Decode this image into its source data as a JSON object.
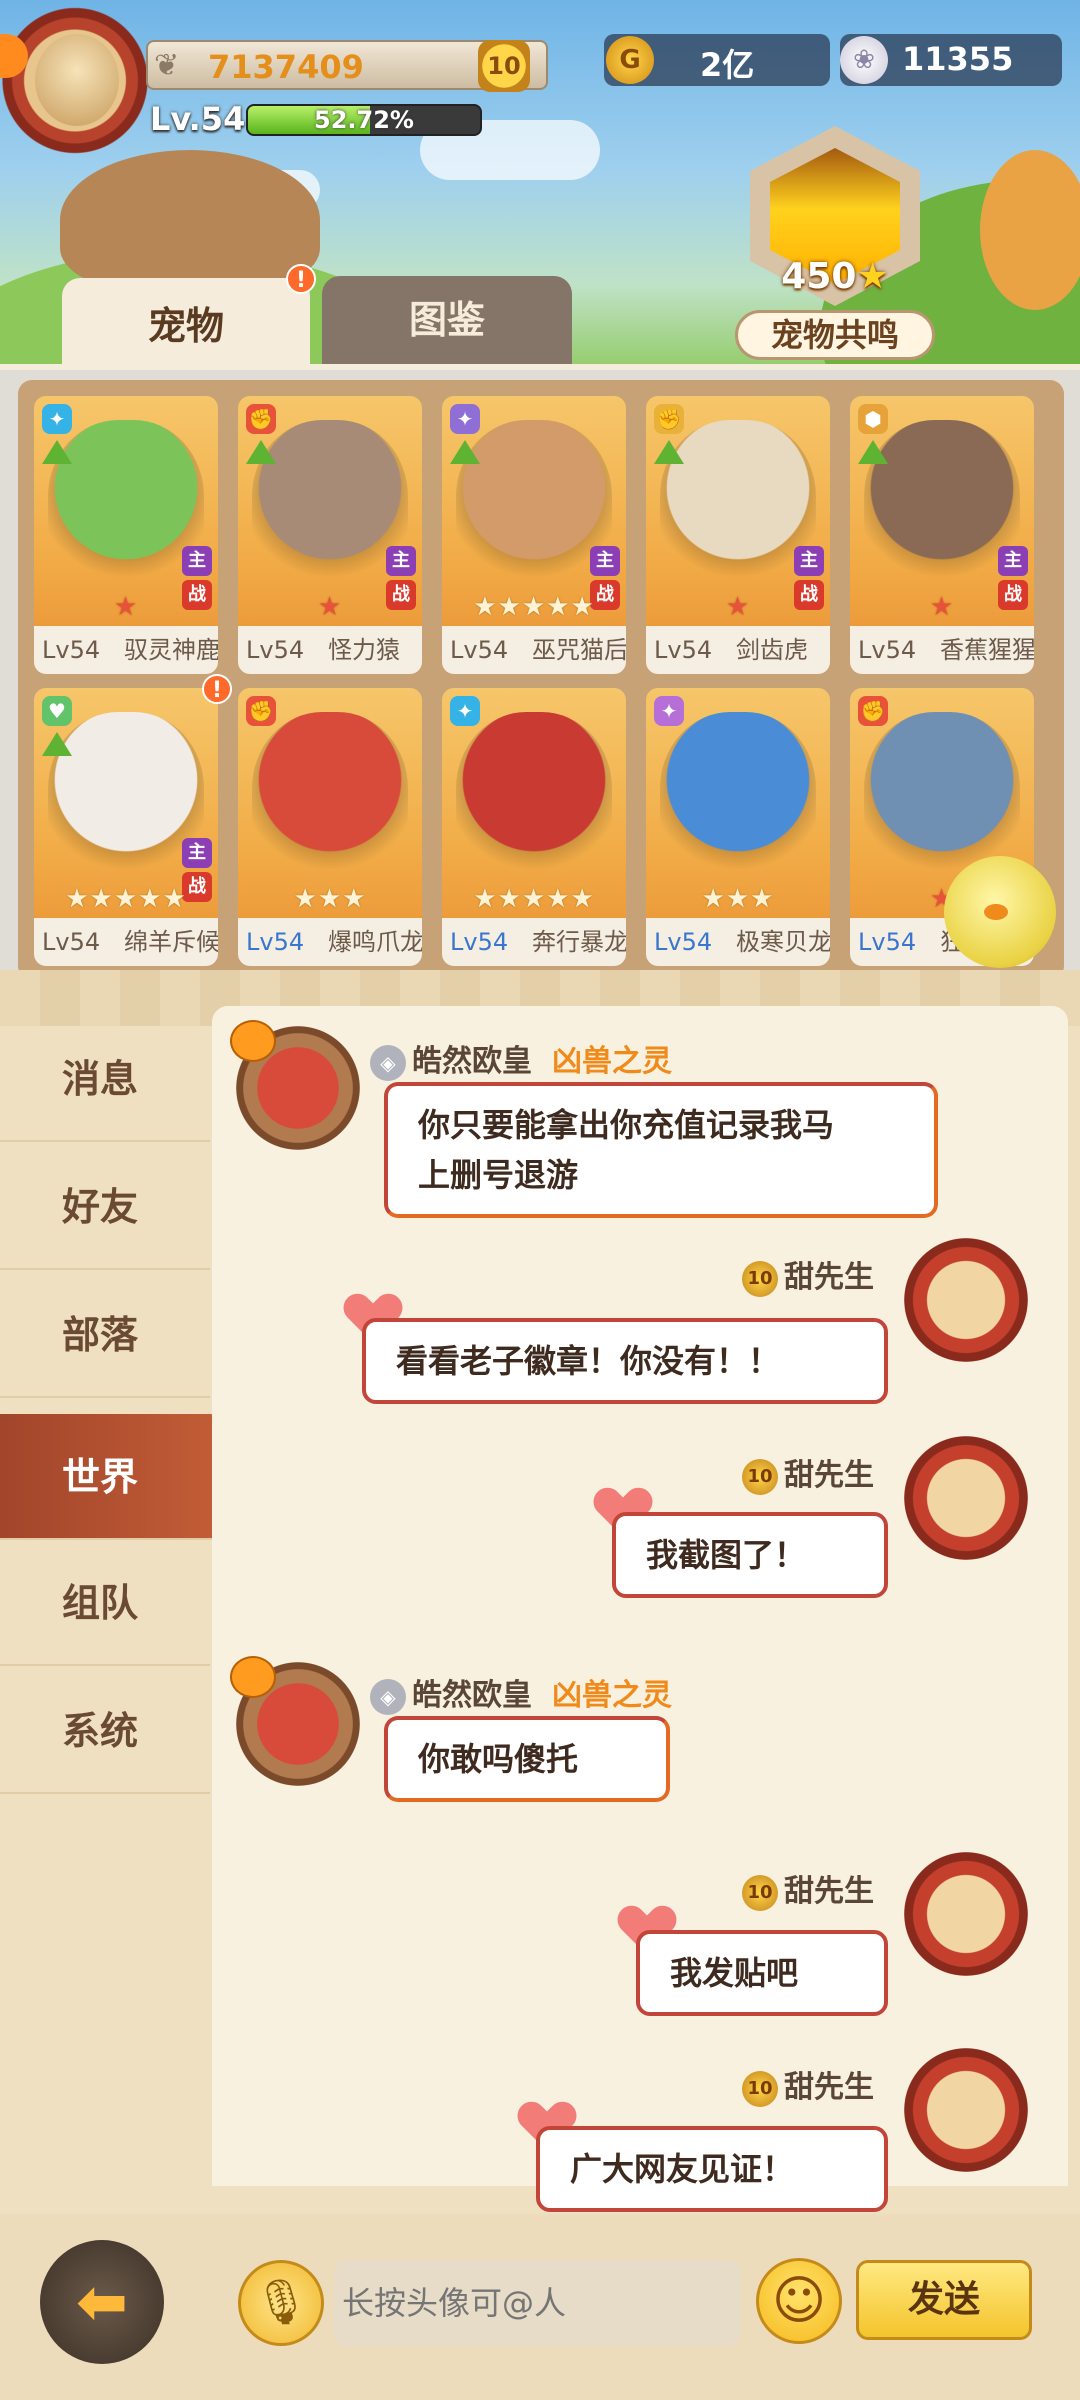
{
  "player": {
    "score": "7137409",
    "vip": "10",
    "level": "Lv.54",
    "exp_percent": "52.72%",
    "exp_fraction": 0.5272
  },
  "resources": {
    "gold": "2亿",
    "gems": "11355"
  },
  "resonance": {
    "value": "450",
    "label": "宠物共鸣"
  },
  "tabs": [
    {
      "label": "宠物",
      "active": true
    },
    {
      "label": "图鉴",
      "active": false
    }
  ],
  "pets": [
    {
      "level": "Lv54",
      "name": "驭灵神鹿",
      "stars": 1,
      "color": "#7cc45a"
    },
    {
      "level": "Lv54",
      "name": "怪力猿",
      "stars": 1,
      "color": "#a78b76"
    },
    {
      "level": "Lv54",
      "name": "巫咒猫后",
      "stars": 5,
      "color": "#d39a6a"
    },
    {
      "level": "Lv54",
      "name": "剑齿虎",
      "stars": 1,
      "color": "#e8d9c1"
    },
    {
      "level": "Lv54",
      "name": "香蕉猩猩",
      "stars": 1,
      "color": "#8b6a55"
    },
    {
      "level": "Lv54",
      "name": "绵羊斥候",
      "stars": 5,
      "color": "#f1ede6"
    },
    {
      "level": "Lv54",
      "name": "爆鸣爪龙",
      "stars": 3,
      "color": "#d84a3a"
    },
    {
      "level": "Lv54",
      "name": "奔行暴龙",
      "stars": 5,
      "color": "#c93a33"
    },
    {
      "level": "Lv54",
      "name": "极寒贝龙",
      "stars": 3,
      "color": "#4a8cd6"
    },
    {
      "level": "Lv54",
      "name": "狂",
      "stars": 1,
      "color": "#6f8fb3"
    }
  ],
  "chat_tabs": [
    "消息",
    "好友",
    "部落",
    "世界",
    "组队",
    "系统"
  ],
  "messages": [
    {
      "side": "left",
      "sender": "皓然欧皇",
      "tag": "凶兽之灵",
      "text1": "你只要能拿出你充值记录我马",
      "text2": "上删号退游"
    },
    {
      "side": "right",
      "sender": "甜先生",
      "text1": "看看老子徽章！你没有！！"
    },
    {
      "side": "right",
      "sender": "甜先生",
      "text1": "我截图了！"
    },
    {
      "side": "left",
      "sender": "皓然欧皇",
      "tag": "凶兽之灵",
      "text1": "你敢吗傻托"
    },
    {
      "side": "right",
      "sender": "甜先生",
      "text1": "我发贴吧"
    },
    {
      "side": "right",
      "sender": "甜先生",
      "text1": "广大网友见证！"
    }
  ],
  "input": {
    "placeholder": "长按头像可@人",
    "send_label": "发送"
  },
  "icons": {
    "back": "back-arrow-icon",
    "mic": "microphone-icon",
    "emoji": "smiley-icon"
  }
}
